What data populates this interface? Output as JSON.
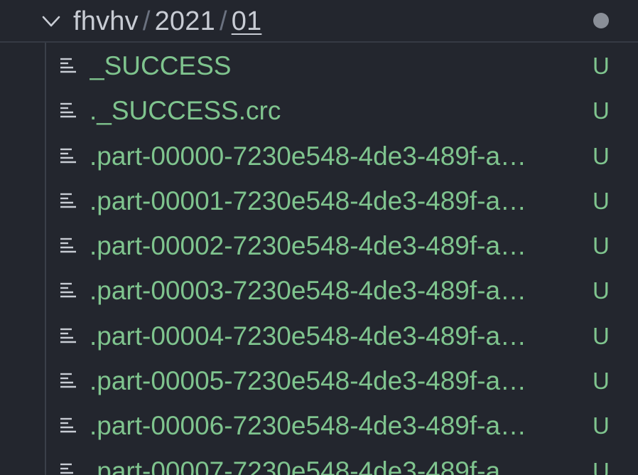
{
  "folder": {
    "breadcrumb": [
      "fhvhv",
      "2021",
      "01"
    ],
    "separator": "/",
    "expanded": true,
    "chevron_icon": "chevron-down-icon",
    "has_unsaved_indicator": true
  },
  "colors": {
    "background": "#23262e",
    "untracked_green": "#7fc48e",
    "breadcrumb_text": "#c8ccd4",
    "dot_gray": "#8a8f98"
  },
  "files": [
    {
      "name": "_SUCCESS",
      "status": "U",
      "icon": "file-lines-icon"
    },
    {
      "name": "._SUCCESS.crc",
      "status": "U",
      "icon": "file-lines-icon"
    },
    {
      "name": ".part-00000-7230e548-4de3-489f-a…",
      "status": "U",
      "icon": "file-lines-icon"
    },
    {
      "name": ".part-00001-7230e548-4de3-489f-a…",
      "status": "U",
      "icon": "file-lines-icon"
    },
    {
      "name": ".part-00002-7230e548-4de3-489f-a…",
      "status": "U",
      "icon": "file-lines-icon"
    },
    {
      "name": ".part-00003-7230e548-4de3-489f-a…",
      "status": "U",
      "icon": "file-lines-icon"
    },
    {
      "name": ".part-00004-7230e548-4de3-489f-a…",
      "status": "U",
      "icon": "file-lines-icon"
    },
    {
      "name": ".part-00005-7230e548-4de3-489f-a…",
      "status": "U",
      "icon": "file-lines-icon"
    },
    {
      "name": ".part-00006-7230e548-4de3-489f-a…",
      "status": "U",
      "icon": "file-lines-icon"
    },
    {
      "name": ".part-00007-7230e548-4de3-489f-a…",
      "status": "U",
      "icon": "file-lines-icon"
    }
  ]
}
